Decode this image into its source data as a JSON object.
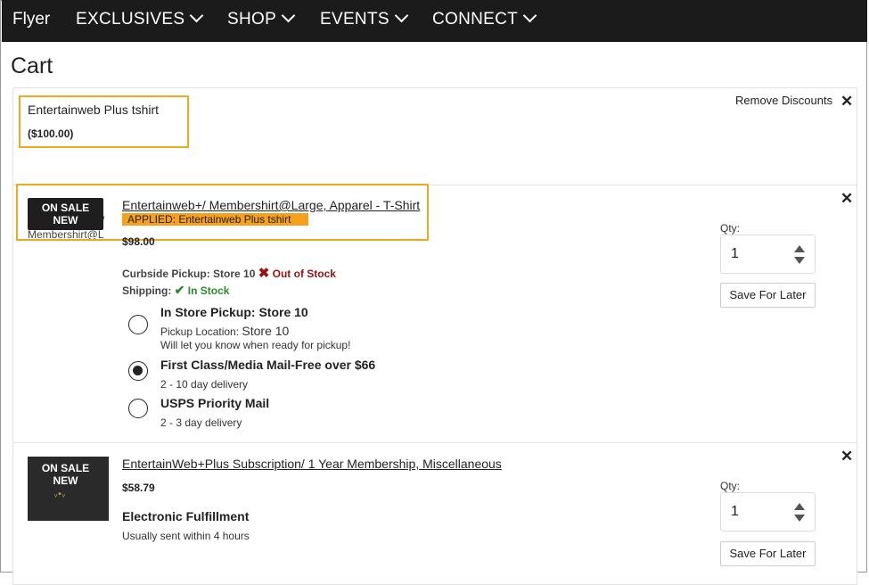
{
  "nav": {
    "brand": "Flyer",
    "items": [
      {
        "label": "EXCLUSIVES"
      },
      {
        "label": "SHOP"
      },
      {
        "label": "EVENTS"
      },
      {
        "label": "CONNECT"
      }
    ]
  },
  "page": {
    "title": "Cart"
  },
  "discount": {
    "name": "Entertainweb Plus tshirt",
    "amount": "($100.00)",
    "remove_label": "Remove Discounts"
  },
  "items": [
    {
      "badge_line1": "ON SALE",
      "badge_line2": "NEW",
      "image_alt_fragment1": "/",
      "image_alt_fragment2": "Membershirt@L",
      "title": "Entertainweb+/ Membershirt@Large, Apparel - T-Shirt",
      "applied": "APPLIED: Entertainweb Plus tshirt",
      "price": "$98.00",
      "curbside_label": "Curbside Pickup: Store 10",
      "curbside_status": "Out of Stock",
      "shipping_label": "Shipping:",
      "shipping_status": "In Stock",
      "options": [
        {
          "title": "In Store Pickup: Store 10",
          "sub1_prefix": "Pickup Location:",
          "sub1_value": "Store 10",
          "sub2": "Will let you know when ready for pickup!",
          "selected": false
        },
        {
          "title": "First Class/Media Mail-Free over $66",
          "sub1": "2 - 10 day delivery",
          "selected": true
        },
        {
          "title": "USPS Priority Mail",
          "sub1": "2 - 3 day delivery",
          "selected": false
        }
      ],
      "qty_label": "Qty:",
      "qty": "1",
      "save_later": "Save For Later"
    },
    {
      "badge_line1": "ON SALE",
      "badge_line2": "NEW",
      "title": "EntertainWeb+Plus Subscription/ 1 Year Membership, Miscellaneous",
      "price": "$58.79",
      "fulfillment": "Electronic Fulfillment",
      "fulfillment_note": "Usually sent within 4 hours",
      "qty_label": "Qty:",
      "qty": "1",
      "save_later": "Save For Later"
    }
  ],
  "icons": {
    "close": "close-icon",
    "chevron": "chevron-down-icon",
    "cross": "red-x-icon",
    "check": "green-check-icon"
  },
  "colors": {
    "accent": "#f5a11c",
    "nav_bg": "#1b1b1b",
    "out_of_stock": "#9b1212",
    "in_stock": "#2c8a2c"
  }
}
